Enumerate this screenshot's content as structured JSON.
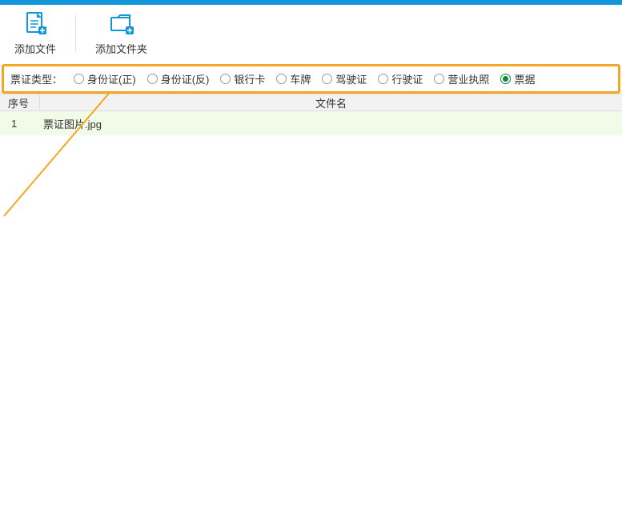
{
  "toolbar": {
    "add_file_label": "添加文件",
    "add_folder_label": "添加文件夹"
  },
  "filter": {
    "caption": "票证类型：",
    "options": [
      {
        "label": "身份证(正)",
        "selected": false
      },
      {
        "label": "身份证(反)",
        "selected": false
      },
      {
        "label": "银行卡",
        "selected": false
      },
      {
        "label": "车牌",
        "selected": false
      },
      {
        "label": "驾驶证",
        "selected": false
      },
      {
        "label": "行驶证",
        "selected": false
      },
      {
        "label": "营业执照",
        "selected": false
      },
      {
        "label": "票据",
        "selected": true
      }
    ]
  },
  "table": {
    "col_index": "序号",
    "col_filename": "文件名",
    "rows": [
      {
        "index": "1",
        "filename": "票证图片.jpg"
      }
    ]
  }
}
